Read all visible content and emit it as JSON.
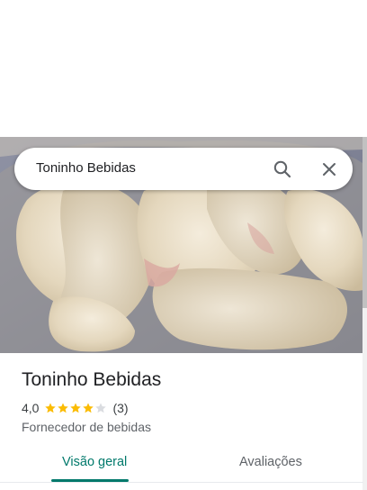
{
  "search": {
    "query": "Toninho Bebidas"
  },
  "icons": {
    "search": "search-icon",
    "close": "close-icon",
    "star": "star-icon"
  },
  "place": {
    "name": "Toninho Bebidas",
    "rating": "4,0",
    "rating_value": 4.0,
    "stars_filled": 4,
    "stars_total": 5,
    "review_count": "(3)",
    "category": "Fornecedor de bebidas"
  },
  "tabs": [
    {
      "label": "Visão geral",
      "active": true
    },
    {
      "label": "Avaliações",
      "active": false
    }
  ],
  "colors": {
    "accent": "#00796b",
    "star_filled": "#fbbc04",
    "star_empty": "#dadce0",
    "text_primary": "#202124",
    "text_secondary": "#5f6368"
  }
}
